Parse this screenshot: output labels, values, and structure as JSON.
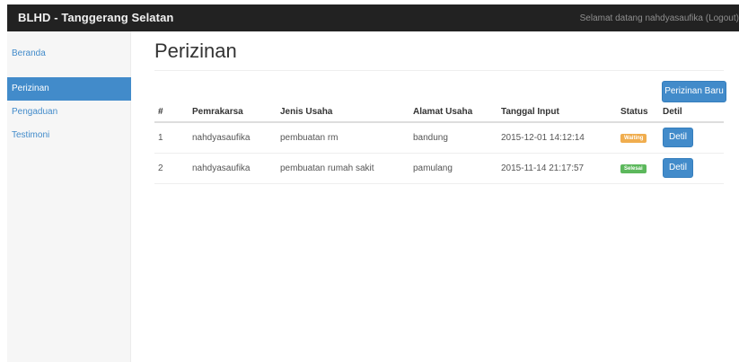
{
  "navbar": {
    "brand": "BLHD - Tanggerang Selatan",
    "welcome_prefix": "Selamat datang nahdyasaufika (",
    "logout_label": "Logout",
    "welcome_suffix": ")"
  },
  "sidebar": {
    "items": [
      {
        "label": "Beranda",
        "active": false
      },
      {
        "label": "Perizinan",
        "active": true
      },
      {
        "label": "Pengaduan",
        "active": false
      },
      {
        "label": "Testimoni",
        "active": false
      }
    ]
  },
  "main": {
    "title": "Perizinan",
    "new_button_label": "Perizinan Baru",
    "table": {
      "headers": [
        "#",
        "Pemrakarsa",
        "Jenis Usaha",
        "Alamat Usaha",
        "Tanggal Input",
        "Status",
        "Detil"
      ],
      "rows": [
        {
          "no": "1",
          "pemrakarsa": "nahdyasaufika",
          "jenis": "pembuatan rm",
          "alamat": "bandung",
          "tanggal": "2015-12-01 14:12:14",
          "status": "Waiting",
          "status_color": "#f0ad4e",
          "detil": "Detil"
        },
        {
          "no": "2",
          "pemrakarsa": "nahdyasaufika",
          "jenis": "pembuatan rumah sakit",
          "alamat": "pamulang",
          "tanggal": "2015-11-14 21:17:57",
          "status": "Selesai",
          "status_color": "#5cb85c",
          "detil": "Detil"
        }
      ]
    }
  },
  "colors": {
    "navbar": "#222222",
    "primary": "#428bca",
    "warning": "#f0ad4e",
    "success": "#5cb85c"
  }
}
